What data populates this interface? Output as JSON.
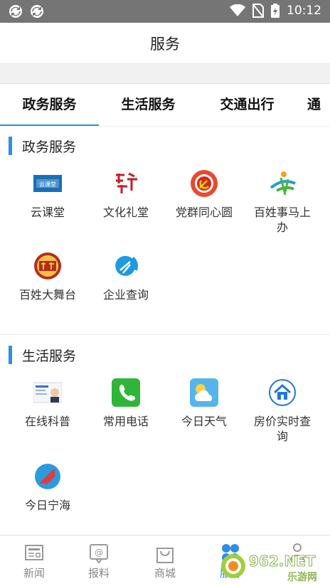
{
  "status_bar": {
    "time": "10:12"
  },
  "header": {
    "title": "服务"
  },
  "tabs": [
    {
      "label": "政务服务",
      "active": true
    },
    {
      "label": "生活服务",
      "active": false
    },
    {
      "label": "交通出行",
      "active": false
    },
    {
      "label": "通",
      "active": false
    }
  ],
  "sections": [
    {
      "title": "政务服务",
      "items": [
        {
          "label": "云课堂",
          "icon": "cloud-class-icon"
        },
        {
          "label": "文化礼堂",
          "icon": "culture-hall-icon"
        },
        {
          "label": "党群同心圆",
          "icon": "party-circle-icon"
        },
        {
          "label": "百姓事马上办",
          "icon": "citizen-affairs-icon"
        },
        {
          "label": "百姓大舞台",
          "icon": "stage-icon"
        },
        {
          "label": "企业查询",
          "icon": "enterprise-query-icon"
        }
      ]
    },
    {
      "title": "生活服务",
      "items": [
        {
          "label": "在线科普",
          "icon": "science-icon"
        },
        {
          "label": "常用电话",
          "icon": "phone-icon"
        },
        {
          "label": "今日天气",
          "icon": "weather-icon"
        },
        {
          "label": "房价实时查询",
          "icon": "house-price-icon"
        },
        {
          "label": "今日宁海",
          "icon": "ninghai-icon"
        }
      ]
    }
  ],
  "bottom_nav": [
    {
      "label": "新闻",
      "icon": "news-icon",
      "active": false
    },
    {
      "label": "报料",
      "icon": "report-icon",
      "active": false
    },
    {
      "label": "商城",
      "icon": "shop-icon",
      "active": false
    },
    {
      "label": "服务",
      "icon": "service-icon",
      "active": true
    },
    {
      "label": "",
      "icon": "profile-icon",
      "active": false
    }
  ],
  "watermark": {
    "text": "962.NET",
    "subtext": "乐游网"
  },
  "colors": {
    "accent": "#2d8ee8",
    "status_bar": "#757575"
  }
}
